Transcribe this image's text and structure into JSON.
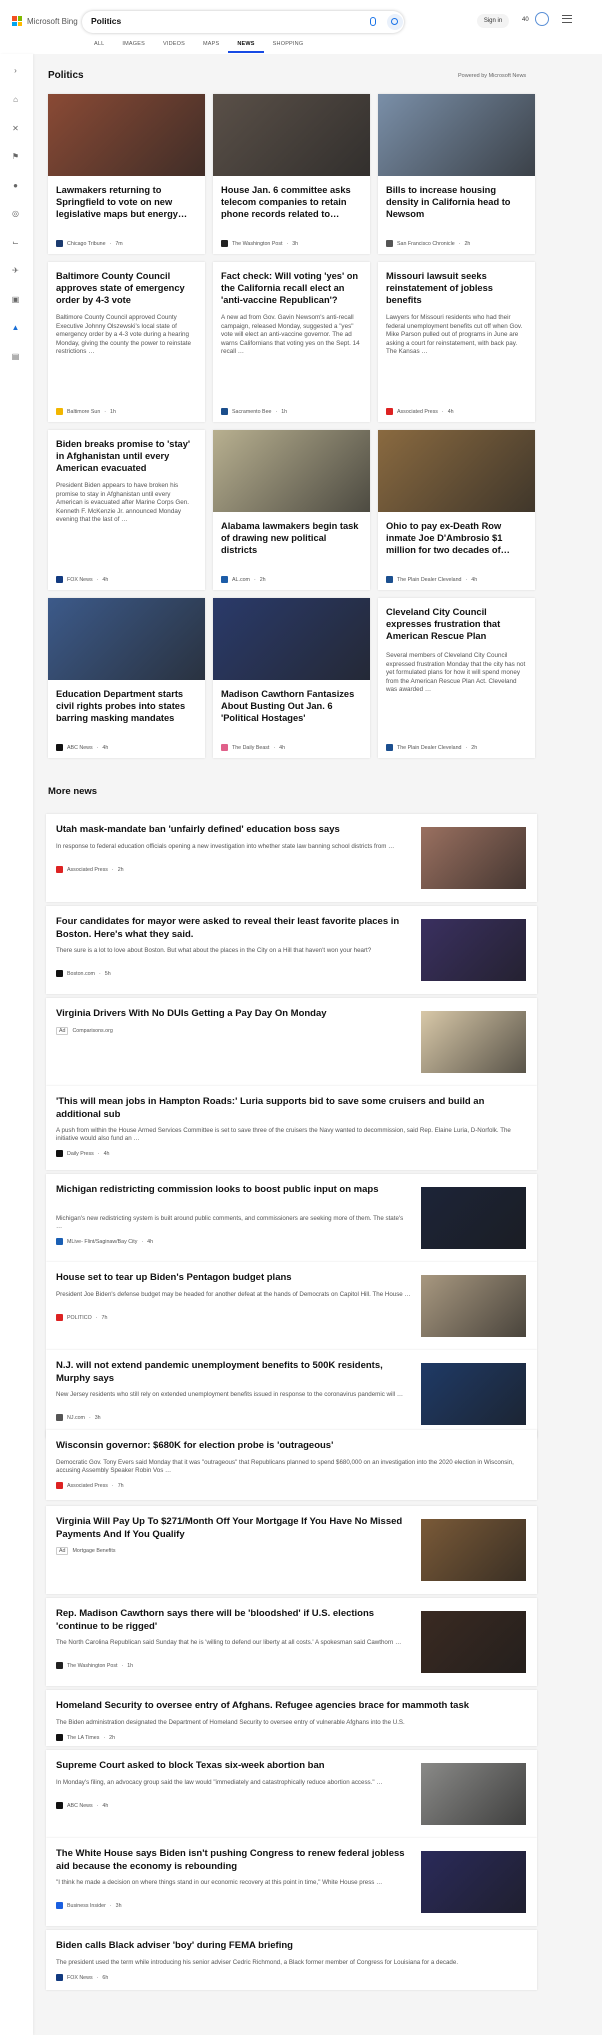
{
  "header": {
    "brand": "Microsoft Bing",
    "search_value": "Politics",
    "sign_in": "Sign in",
    "points": "40"
  },
  "tabs": [
    {
      "label": "ALL"
    },
    {
      "label": "IMAGES"
    },
    {
      "label": "VIDEOS"
    },
    {
      "label": "MAPS"
    },
    {
      "label": "NEWS"
    },
    {
      "label": "SHOPPING"
    }
  ],
  "section": {
    "title": "Politics",
    "powered_by": "Powered by Microsoft News"
  },
  "cards": [
    {
      "title": "Lawmakers returning to Springfield to vote on new legislative maps but energy…",
      "snippet": "",
      "source": "Chicago Tribune",
      "time": "7m",
      "img": "#8a4a35",
      "src_color": "#1c3b6f"
    },
    {
      "title": "House Jan. 6 committee asks telecom companies to retain phone records related to…",
      "snippet": "",
      "source": "The Washington Post",
      "time": "3h",
      "img": "#5a5048",
      "src_color": "#222"
    },
    {
      "title": "Bills to increase housing density in California head to Newsom",
      "snippet": "",
      "source": "San Francisco Chronicle",
      "time": "2h",
      "img": "#7a8fa8",
      "src_color": "#555"
    },
    {
      "title": "Baltimore County Council approves state of emergency order by 4-3 vote",
      "snippet": "Baltimore County Council approved County Executive Johnny Olszewski's local state of emergency order by a 4-3 vote during a hearing Monday, giving the county the power to reinstate restrictions …",
      "source": "Baltimore Sun",
      "time": "1h",
      "img": "",
      "src_color": "#f2b600"
    },
    {
      "title": "Fact check: Will voting 'yes' on the California recall elect an 'anti-vaccine Republican'?",
      "snippet": "A new ad from Gov. Gavin Newsom's anti-recall campaign, released Monday, suggested a \"yes\" vote will elect an anti-vaccine governor. The ad warns Californians that voting yes on the Sept. 14 recall …",
      "source": "Sacramento Bee",
      "time": "1h",
      "img": "",
      "src_color": "#1b4e8c"
    },
    {
      "title": "Missouri lawsuit seeks reinstatement of jobless benefits",
      "snippet": "Lawyers for Missouri residents who had their federal unemployment benefits cut off when Gov. Mike Parson pulled out of programs in June are asking a court for reinstatement, with back pay. The Kansas …",
      "source": "Associated Press",
      "time": "4h",
      "img": "",
      "src_color": "#d22"
    },
    {
      "title": "Biden breaks promise to 'stay' in Afghanistan until every American evacuated",
      "snippet": "President Biden appears to have broken his promise to stay in Afghanistan until every American is evacuated after Marine Corps Gen. Kenneth F. McKenzie Jr. announced Monday evening that the last of …",
      "source": "FOX News",
      "time": "4h",
      "img": "",
      "src_color": "#123a80"
    },
    {
      "title": "Alabama lawmakers begin task of drawing new political districts",
      "snippet": "",
      "source": "AL.com",
      "time": "2h",
      "img": "#b8b090",
      "src_color": "#1d5da8"
    },
    {
      "title": "Ohio to pay ex-Death Row inmate Joe D'Ambrosio $1 million for two decades of…",
      "snippet": "",
      "source": "The Plain Dealer Cleveland",
      "time": "4h",
      "img": "#8a6a40",
      "src_color": "#1b4f8f"
    },
    {
      "title": "Education Department starts civil rights probes into states barring masking mandates",
      "snippet": "",
      "source": "ABC News",
      "time": "4h",
      "img": "#3c5a8a",
      "src_color": "#111"
    },
    {
      "title": "Madison Cawthorn Fantasizes About Busting Out Jan. 6 'Political Hostages'",
      "snippet": "",
      "source": "The Daily Beast",
      "time": "4h",
      "img": "#2a3a6a",
      "src_color": "#e0608a"
    },
    {
      "title": "Cleveland City Council expresses frustration that American Rescue Plan money…",
      "snippet": "Several members of Cleveland City Council expressed frustration Monday that the city has not yet formulated plans for how it will spend money from the American Rescue Plan Act. Cleveland was awarded …",
      "source": "The Plain Dealer Cleveland",
      "time": "2h",
      "img": "",
      "src_color": "#1b4f8f"
    }
  ],
  "more_news": {
    "title": "More news",
    "items": [
      {
        "title": "Utah mask-mandate ban 'unfairly defined' education boss says",
        "snippet": "In response to federal education officials opening a new investigation into whether state law banning school districts from …",
        "source": "Associated Press",
        "time": "2h",
        "img": "#9a7060",
        "ad": "",
        "src_color": "#d22"
      },
      {
        "title": "Four candidates for mayor were asked to reveal their least favorite places in Boston. Here's what they said.",
        "snippet": "There sure is a lot to love about Boston. But what about the places in the City on a Hill that haven't won your heart?",
        "source": "Boston.com",
        "time": "5h",
        "img": "#3a3060",
        "ad": "",
        "src_color": "#111"
      },
      {
        "title": "Virginia Drivers With No DUIs Getting a Pay Day On Monday",
        "snippet": "",
        "source": "Comparisons.org",
        "time": "",
        "img": "#d8c8a8",
        "ad": "Ad",
        "src_color": ""
      },
      {
        "title": "'This will mean jobs in Hampton Roads:' Luria supports bid to save some cruisers and build an additional sub",
        "snippet": "A push from within the House Armed Services Committee is set to save three of the cruisers the Navy wanted to decommission, said Rep. Elaine Luria, D-Norfolk. The initiative would also fund an …",
        "source": "Daily Press",
        "time": "4h",
        "img": "",
        "ad": "",
        "src_color": "#111"
      },
      {
        "title": "Michigan redistricting commission looks to boost public input on maps",
        "snippet": "Michigan's new redistricting system is built around public comments, and commissioners are seeking more of them. The state's …",
        "source": "MLive- Flint/Saginaw/Bay City",
        "time": "4h",
        "img": "#1c2438",
        "ad": "",
        "src_color": "#1a5fb4"
      },
      {
        "title": "House set to tear up Biden's Pentagon budget plans",
        "snippet": "President Joe Biden's defense budget may be headed for another defeat at the hands of Democrats on Capitol Hill. The House …",
        "source": "POLITICO",
        "time": "7h",
        "img": "#a89880",
        "ad": "",
        "src_color": "#d22"
      },
      {
        "title": "N.J. will not extend pandemic unemployment benefits to 500K residents, Murphy says",
        "snippet": "New Jersey residents who still rely on extended unemployment benefits issued in response to the coronavirus pandemic will …",
        "source": "NJ.com",
        "time": "3h",
        "img": "#1f3a66",
        "ad": "",
        "src_color": "#555"
      },
      {
        "title": "Wisconsin governor: $680K for election probe is 'outrageous'",
        "snippet": "Democratic Gov. Tony Evers said Monday that it was \"outrageous\" that Republicans planned to spend $680,000 on an investigation into the 2020 election in Wisconsin, accusing Assembly Speaker Robin Vos …",
        "source": "Associated Press",
        "time": "7h",
        "img": "",
        "ad": "",
        "src_color": "#d22"
      },
      {
        "title": "Virginia Will Pay Up To $271/Month Off Your Mortgage If You Have No Missed Payments And If You Qualify",
        "snippet": "",
        "source": "Mortgage Benefits",
        "time": "",
        "img": "#7a5a38",
        "ad": "Ad",
        "src_color": ""
      },
      {
        "title": "Rep. Madison Cawthorn says there will be 'bloodshed' if U.S. elections 'continue to be rigged'",
        "snippet": "The North Carolina Republican said Sunday that he is 'willing to defend our liberty at all costs.' A spokesman said Cawthorn …",
        "source": "The Washington Post",
        "time": "1h",
        "img": "#3a2a22",
        "ad": "",
        "src_color": "#222"
      },
      {
        "title": "Homeland Security to oversee entry of Afghans. Refugee agencies brace for mammoth task",
        "snippet": "The Biden administration designated the Department of Homeland Security to oversee entry of vulnerable Afghans into the U.S.",
        "source": "The LA Times",
        "time": "2h",
        "img": "",
        "ad": "",
        "src_color": "#111"
      },
      {
        "title": "Supreme Court asked to block Texas six-week abortion ban",
        "snippet": "In Monday's filing, an advocacy group said the law would \"immediately and catastrophically reduce abortion access.\" …",
        "source": "ABC News",
        "time": "4h",
        "img": "#8a8a88",
        "ad": "",
        "src_color": "#111"
      },
      {
        "title": "The White House says Biden isn't pushing Congress to renew federal jobless aid because the economy is rebounding",
        "snippet": "\"I think he made a decision on where things stand in our economic recovery at this point in time,\" White House press …",
        "source": "Business Insider",
        "time": "3h",
        "img": "#2a2a5a",
        "ad": "",
        "src_color": "#1a5fe0"
      },
      {
        "title": "Biden calls Black adviser 'boy' during FEMA briefing",
        "snippet": "The president used the term while introducing his senior adviser Cedric Richmond, a Black former member of Congress for Louisiana for a decade.",
        "source": "FOX News",
        "time": "6h",
        "img": "",
        "ad": "",
        "src_color": "#123a80"
      }
    ]
  }
}
